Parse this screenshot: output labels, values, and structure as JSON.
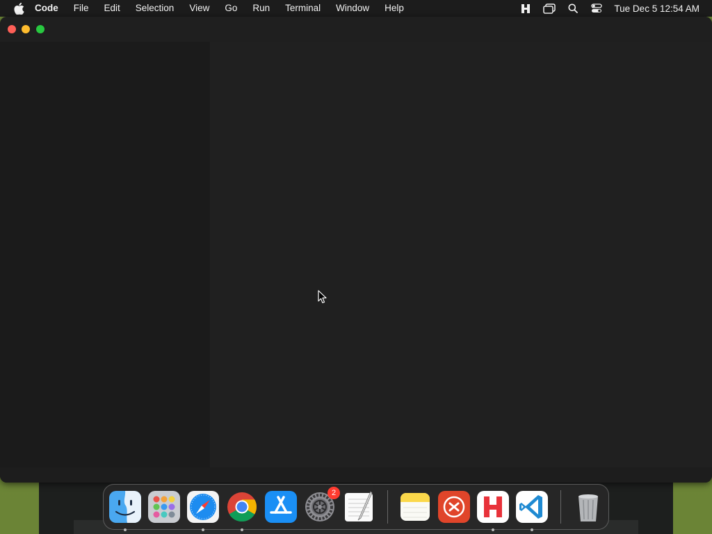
{
  "menubar": {
    "apple_icon": "apple-logo-icon",
    "app_name": "Code",
    "items": [
      "File",
      "Edit",
      "Selection",
      "View",
      "Go",
      "Run",
      "Terminal",
      "Window",
      "Help"
    ],
    "status_icons": [
      "heyday-h-icon",
      "window-switcher-icon",
      "spotlight-search-icon",
      "control-center-icon"
    ],
    "clock": "Tue Dec 5  12:54 AM"
  },
  "window": {
    "controls": [
      "close",
      "minimize",
      "maximize"
    ],
    "colors": {
      "close": "#fe5f57",
      "minimize": "#febc2e",
      "maximize": "#28c840"
    }
  },
  "dock": {
    "items": [
      {
        "name": "finder",
        "icon": "finder-icon",
        "running": true
      },
      {
        "name": "launchpad",
        "icon": "launchpad-icon",
        "running": false
      },
      {
        "name": "safari",
        "icon": "safari-icon",
        "running": true
      },
      {
        "name": "chrome",
        "icon": "chrome-icon",
        "running": true
      },
      {
        "name": "app-store",
        "icon": "app-store-icon",
        "running": false
      },
      {
        "name": "system-settings",
        "icon": "system-settings-icon",
        "running": false,
        "badge": "2"
      },
      {
        "name": "textedit",
        "icon": "textedit-icon",
        "running": false
      },
      {
        "name": "notes",
        "icon": "notes-icon",
        "running": false
      },
      {
        "name": "remote-desktop",
        "icon": "remote-desktop-icon",
        "running": false
      },
      {
        "name": "heyday",
        "icon": "heyday-icon",
        "running": true
      },
      {
        "name": "vscode",
        "icon": "vscode-icon",
        "running": true
      },
      {
        "name": "trash",
        "icon": "trash-icon",
        "running": false
      }
    ]
  }
}
